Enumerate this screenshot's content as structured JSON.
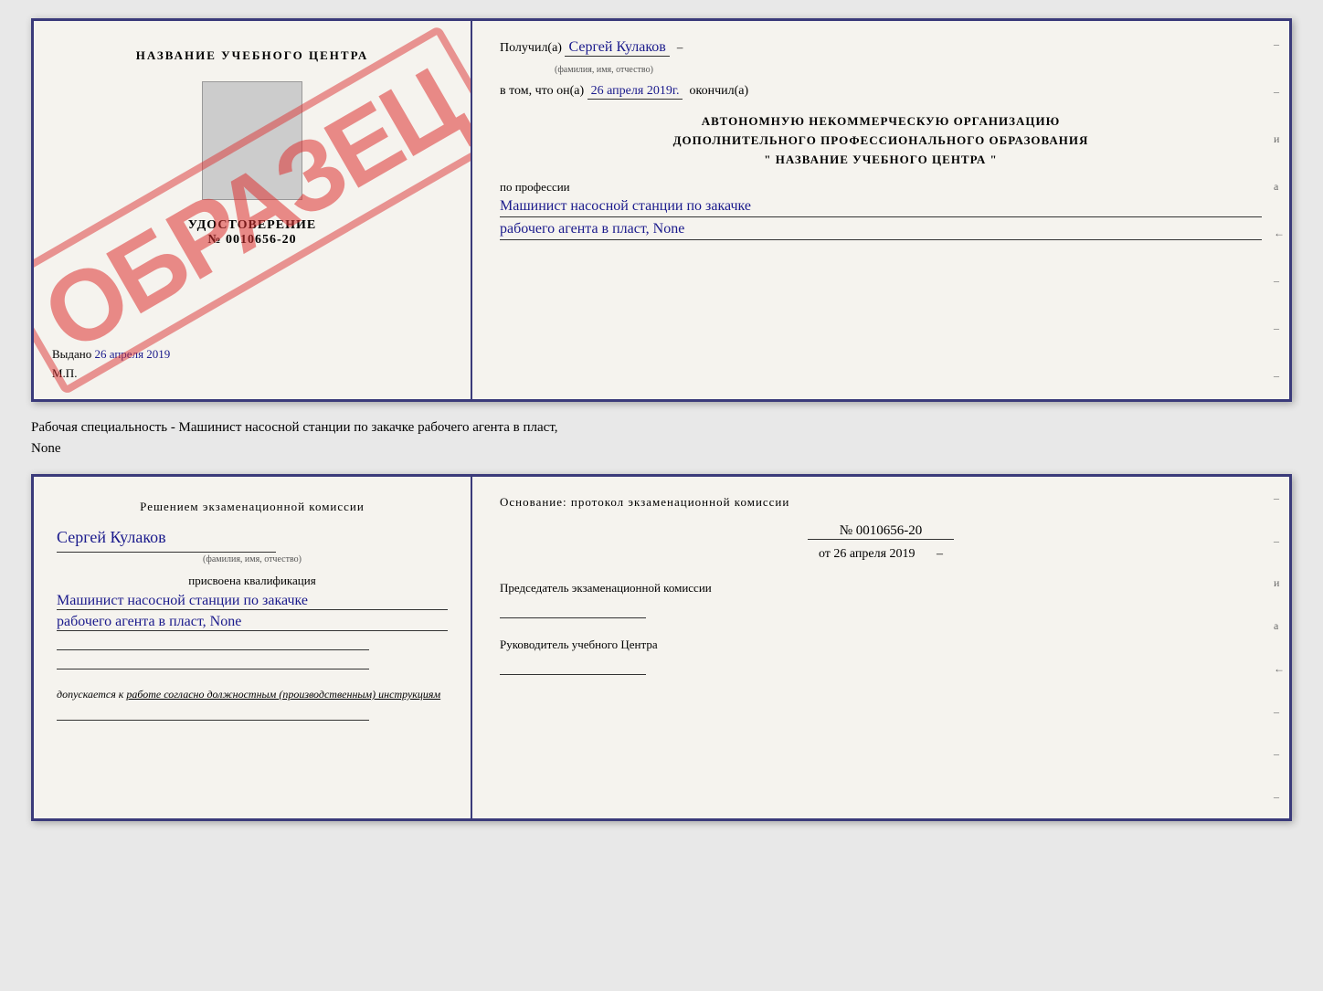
{
  "page": {
    "background": "#e8e8e8"
  },
  "top_cert": {
    "left": {
      "title": "НАЗВАНИЕ УЧЕБНОГО ЦЕНТРА",
      "doc_type": "УДОСТОВЕРЕНИЕ",
      "doc_number": "№ 0010656-20",
      "issued_label": "Выдано",
      "issued_date": "26 апреля 2019",
      "mp_label": "М.П.",
      "watermark": "ОБРАЗЕЦ"
    },
    "right": {
      "received_label": "Получил(а)",
      "received_name": "Сергей Кулаков",
      "received_sub": "(фамилия, имя, отчество)",
      "date_label": "в том, что он(а)",
      "date_value": "26 апреля 2019г.",
      "finished_label": "окончил(а)",
      "org_line1": "АВТОНОМНУЮ НЕКОММЕРЧЕСКУЮ ОРГАНИЗАЦИЮ",
      "org_line2": "ДОПОЛНИТЕЛЬНОГО ПРОФЕССИОНАЛЬНОГО ОБРАЗОВАНИЯ",
      "org_line3": "\"   НАЗВАНИЕ УЧЕБНОГО ЦЕНТРА   \"",
      "profession_label": "по профессии",
      "profession_line1": "Машинист насосной станции по закачке",
      "profession_line2": "рабочего агента в пласт, None"
    }
  },
  "middle_text": {
    "line1": "Рабочая специальность - Машинист насосной станции по закачке рабочего агента в пласт,",
    "line2": "None"
  },
  "bottom_cert": {
    "left": {
      "decision_text": "Решением экзаменационной комиссии",
      "name": "Сергей Кулаков",
      "name_sub": "(фамилия, имя, отчество)",
      "assigned_label": "присвоена квалификация",
      "qualification_line1": "Машинист насосной станции по закачке",
      "qualification_line2": "рабочего агента в пласт, None",
      "allowed_prefix": "допускается к",
      "allowed_text": "работе согласно должностным (производственным) инструкциям"
    },
    "right": {
      "basis_label": "Основание: протокол экзаменационной комиссии",
      "protocol_number": "№ 0010656-20",
      "protocol_date_prefix": "от",
      "protocol_date": "26 апреля 2019",
      "chairman_label": "Председатель экзаменационной комиссии",
      "head_label": "Руководитель учебного Центра"
    }
  }
}
